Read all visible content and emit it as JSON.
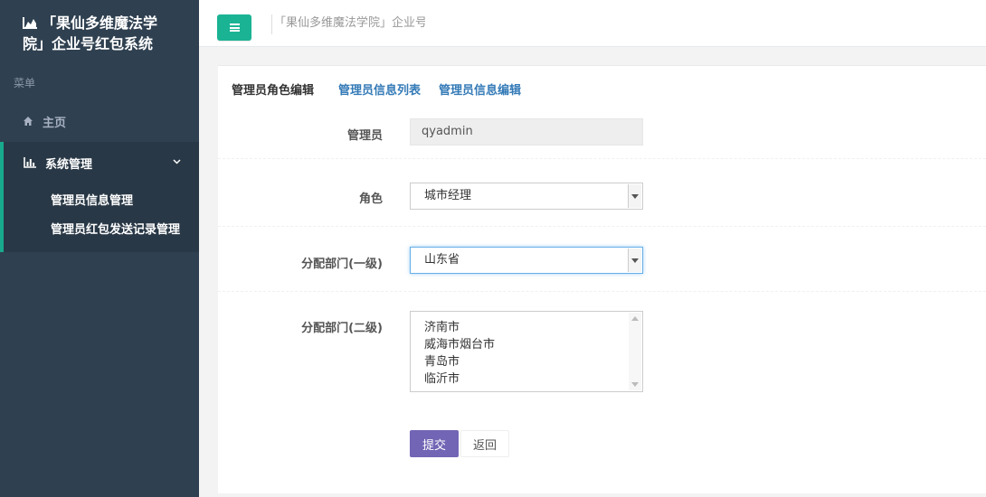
{
  "sidebar": {
    "brand_line1": "「果仙多维魔法学",
    "brand_line2": "院」企业号红包系统",
    "menu_caption": "菜单",
    "home": {
      "icon": "home-icon",
      "label": "主页"
    },
    "system": {
      "icon": "bar-chart-icon",
      "label": "系统管理",
      "items": [
        {
          "label": "管理员信息管理"
        },
        {
          "label": "管理员红包发送记录管理"
        }
      ]
    }
  },
  "topbar": {
    "menu_toggle_icon": "hamburger-icon",
    "tab_label": "「果仙多维魔法学院」企业号"
  },
  "tabs": [
    {
      "label": "管理员角色编辑",
      "active": true
    },
    {
      "label": "管理员信息列表",
      "active": false
    },
    {
      "label": "管理员信息编辑",
      "active": false
    }
  ],
  "form": {
    "admin": {
      "label": "管理员",
      "value": "qyadmin"
    },
    "role": {
      "label": "角色",
      "value": "城市经理"
    },
    "dept1": {
      "label": "分配部门(一级)",
      "value": "山东省"
    },
    "dept2": {
      "label": "分配部门(二级)",
      "options": [
        "济南市",
        "威海市烟台市",
        "青岛市",
        "临沂市"
      ]
    },
    "submit_label": "提交",
    "back_label": "返回"
  },
  "colors": {
    "sidebar": "#2f4050",
    "accent": "#1ab394",
    "submit": "#7265b5",
    "link": "#337ab7"
  }
}
